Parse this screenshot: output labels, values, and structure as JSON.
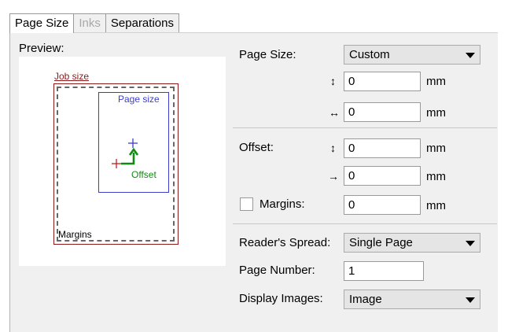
{
  "tabs": [
    {
      "label": "Page Size",
      "state": "active"
    },
    {
      "label": "Inks",
      "state": "disabled"
    },
    {
      "label": "Separations",
      "state": "normal"
    }
  ],
  "preview": {
    "label": "Preview:",
    "job_size_label": "Job size",
    "page_size_label": "Page size",
    "offset_label": "Offset",
    "margins_label": "Margins"
  },
  "form": {
    "page_size": {
      "label": "Page Size:",
      "value": "Custom"
    },
    "height": {
      "icon": "↕",
      "value": "0",
      "unit": "mm"
    },
    "width": {
      "icon": "↔",
      "value": "0",
      "unit": "mm"
    },
    "offset": {
      "label": "Offset:"
    },
    "offset_y": {
      "icon": "↕",
      "value": "0",
      "unit": "mm"
    },
    "offset_x": {
      "icon": "→",
      "value": "0",
      "unit": "mm"
    },
    "margins": {
      "label": "Margins:",
      "value": "0",
      "unit": "mm",
      "checked": false
    },
    "readers_spread": {
      "label": "Reader's Spread:",
      "value": "Single Page"
    },
    "page_number": {
      "label": "Page Number:",
      "value": "1"
    },
    "display_images": {
      "label": "Display Images:",
      "value": "Image"
    }
  },
  "colors": {
    "job": "#8b1a1a",
    "page": "#3c3ccf",
    "offset": "#138a13",
    "margin": "#666666"
  }
}
